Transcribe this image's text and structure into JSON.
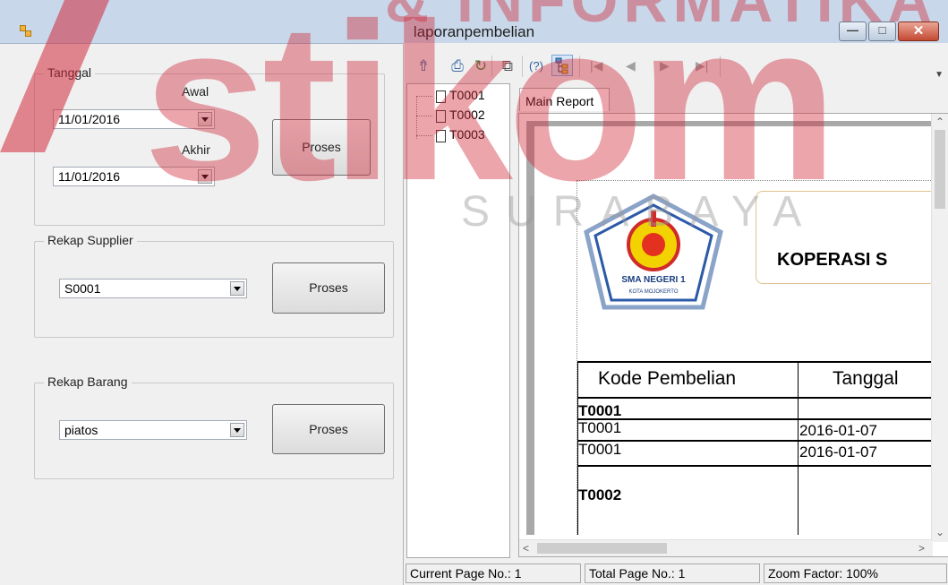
{
  "window": {
    "title": "laporanpembelian"
  },
  "tanggal_group": {
    "legend": "Tanggal",
    "awal_label": "Awal",
    "awal_value": "11/01/2016",
    "akhir_label": "Akhir",
    "akhir_value": "11/01/2016",
    "button": "Proses"
  },
  "supplier_group": {
    "legend": "Rekap Supplier",
    "value": "S0001",
    "button": "Proses"
  },
  "barang_group": {
    "legend": "Rekap Barang",
    "value": "piatos",
    "button": "Proses"
  },
  "viewer": {
    "help_text": "(?)",
    "tree": [
      "T0001",
      "T0002",
      "T0003"
    ],
    "tab": "Main Report",
    "company": "KOPERASI S",
    "logo_text": "SMA NEGERI 1",
    "logo_subtext": "KOTA MOJOKERTO",
    "table": {
      "headers": [
        "Kode Pembelian",
        "Tanggal"
      ],
      "group1": "T0001",
      "rows": [
        {
          "kode": "T0001",
          "tanggal": "2016-01-07"
        },
        {
          "kode": "T0001",
          "tanggal": "2016-01-07"
        }
      ],
      "group2": "T0002"
    },
    "status": {
      "current_page": "Current Page No.: 1",
      "total_page": "Total Page No.: 1",
      "zoom": "Zoom Factor: 100%"
    }
  },
  "watermark": {
    "brand": "stikom",
    "tagline": "& INFORMATIKA",
    "city": "SURABAYA"
  },
  "colors": {
    "titlebar": "#c8d8ea",
    "close": "#c44a33",
    "watermark": "#d12a3a"
  }
}
